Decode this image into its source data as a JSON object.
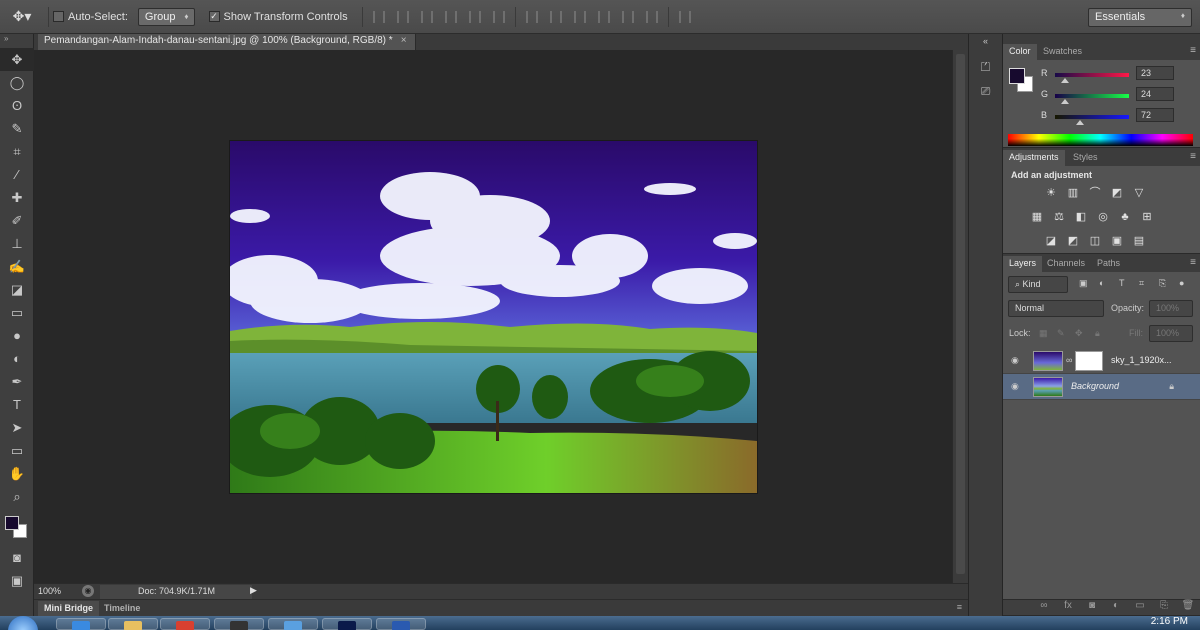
{
  "options_bar": {
    "auto_select_label": "Auto-Select:",
    "auto_select_checked": false,
    "auto_select_target": "Group",
    "transform_controls_label": "Show Transform Controls",
    "transform_controls_checked": true,
    "workspace": "Essentials"
  },
  "document": {
    "tab_title": "Pemandangan-Alam-Indah-danau-sentani.jpg @ 100% (Background, RGB/8) *",
    "tab_close": "×"
  },
  "status_bar": {
    "zoom": "100%",
    "doc_info": "Doc: 704.9K/1.71M"
  },
  "bottom_tabs": [
    "Mini Bridge",
    "Timeline"
  ],
  "toolbar": {
    "foreground_color": "#170a2e",
    "background_color": "#ffffff",
    "tools": [
      "move-tool",
      "marquee-tool",
      "lasso-tool",
      "quick-selection-tool",
      "crop-tool",
      "eyedropper-tool",
      "spot-healing-tool",
      "brush-tool",
      "clone-stamp-tool",
      "history-brush-tool",
      "eraser-tool",
      "gradient-tool",
      "blur-tool",
      "dodge-tool",
      "pen-tool",
      "type-tool",
      "path-selection-tool",
      "rectangle-tool",
      "hand-tool",
      "zoom-tool"
    ]
  },
  "color_panel": {
    "tabs": [
      "Color",
      "Swatches"
    ],
    "r_label": "R",
    "r_value": "23",
    "g_label": "G",
    "g_value": "24",
    "b_label": "B",
    "b_value": "72"
  },
  "adjustments_panel": {
    "tabs": [
      "Adjustments",
      "Styles"
    ],
    "title": "Add an adjustment"
  },
  "layers_panel": {
    "tabs": [
      "Layers",
      "Channels",
      "Paths"
    ],
    "filter_kind": "Kind",
    "blend_mode": "Normal",
    "opacity_label": "Opacity:",
    "opacity_value": "100%",
    "lock_label": "Lock:",
    "fill_label": "Fill:",
    "fill_value": "100%",
    "layers": [
      {
        "name": "sky_1_1920x...",
        "selected": false,
        "has_mask": true
      },
      {
        "name": "Background",
        "selected": true,
        "locked": true
      }
    ]
  },
  "taskbar": {
    "clock": "2:16 PM"
  }
}
